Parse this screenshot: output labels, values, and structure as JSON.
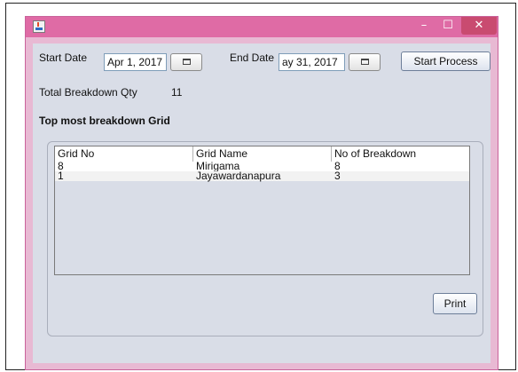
{
  "window": {
    "buttons": {
      "minimize": "–",
      "maximize": "☐",
      "close": "✕"
    }
  },
  "form": {
    "start_date_label": "Start Date",
    "start_date_value": "Apr 1, 2017",
    "end_date_label": "End Date",
    "end_date_value": "ay 31, 2017",
    "start_process_label": "Start Process",
    "total_label": "Total Breakdown Qty",
    "total_value": "11"
  },
  "grid_section": {
    "title": "Top most breakdown Grid",
    "columns": [
      "Grid No",
      "Grid Name",
      "No of Breakdown"
    ],
    "rows": [
      [
        "8",
        "Mirigama",
        "8"
      ],
      [
        "1",
        "Jayawardanapura",
        "3"
      ]
    ],
    "print_label": "Print"
  },
  "colors": {
    "title_bar": "#df6ba5",
    "close_button": "#c94b70",
    "panel": "#d9dde7"
  }
}
